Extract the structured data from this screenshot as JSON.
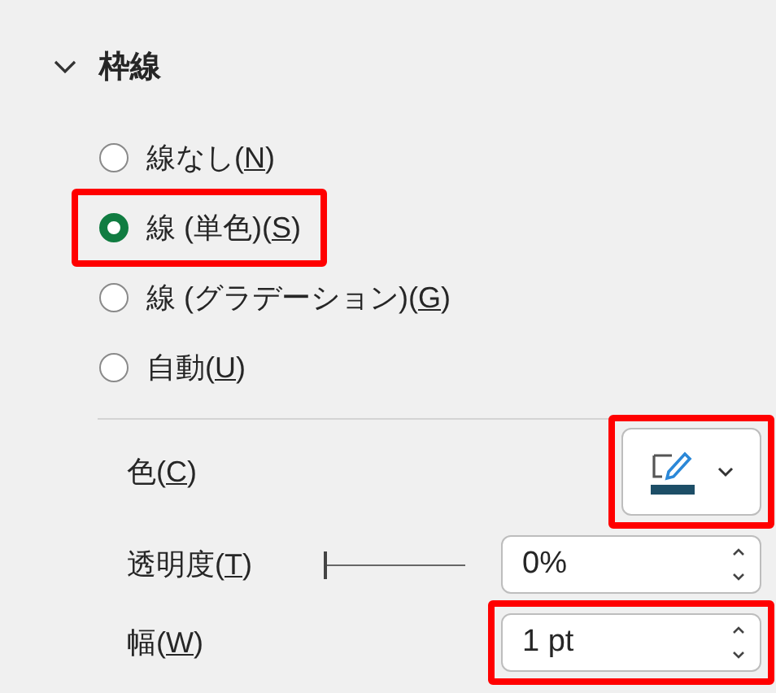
{
  "section": {
    "title": "枠線",
    "expanded": true
  },
  "line_options": [
    {
      "label_before": "線なし(",
      "access_key": "N",
      "label_after": ")",
      "selected": false,
      "highlighted": false
    },
    {
      "label_before": "線 (単色)(",
      "access_key": "S",
      "label_after": ")",
      "selected": true,
      "highlighted": true
    },
    {
      "label_before": "線 (グラデーション)(",
      "access_key": "G",
      "label_after": ")",
      "selected": false,
      "highlighted": false
    },
    {
      "label_before": "自動(",
      "access_key": "U",
      "label_after": ")",
      "selected": false,
      "highlighted": false
    }
  ],
  "properties": [
    {
      "kind": "color",
      "label_before": "色(",
      "access_key": "C",
      "label_after": ")",
      "color": "#1d4e67",
      "highlighted": true
    },
    {
      "kind": "slider",
      "label_before": "透明度(",
      "access_key": "T",
      "label_after": ")",
      "level": 0,
      "value": "0%",
      "highlighted": false
    },
    {
      "kind": "spin",
      "label_before": "幅(",
      "access_key": "W",
      "label_after": ")",
      "value": "1 pt",
      "highlighted": true
    }
  ]
}
